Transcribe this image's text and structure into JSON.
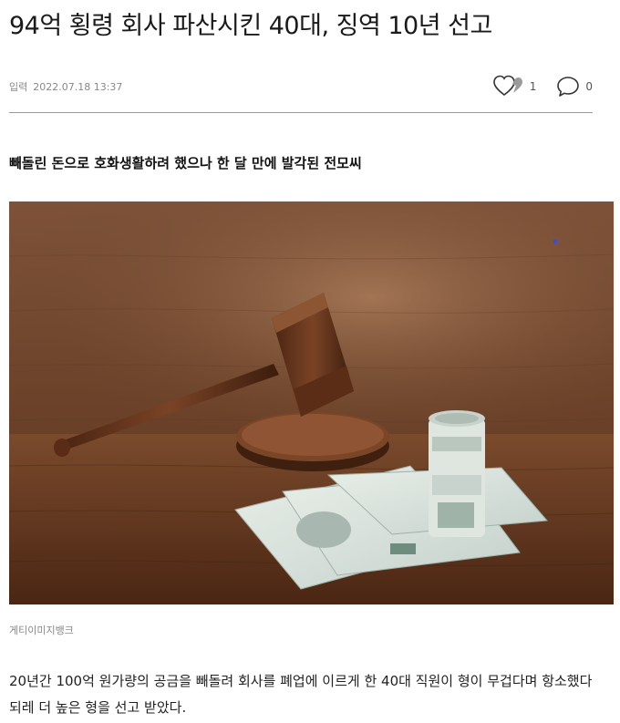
{
  "article": {
    "headline": "94억 횡령 회사 파산시킨 40대, 징역 10년 선고",
    "date_label": "입력",
    "date_value": "2022.07.18 13:37",
    "like_count": "1",
    "comment_count": "0",
    "subheadline": "빼돌린 돈으로 호화생활하려 했으나 한 달 만에 발각된 전모씨",
    "photo_caption": "게티이미지뱅크",
    "body": "20년간 100억 원가량의 공금을 빼돌려 회사를 폐업에 이르게 한 40대 직원이 형이 무겁다며 항소했다 되레 더 높은 형을 선고 받았다.",
    "icons": {
      "like": "heart-icon",
      "comment": "speech-bubble-icon"
    }
  }
}
